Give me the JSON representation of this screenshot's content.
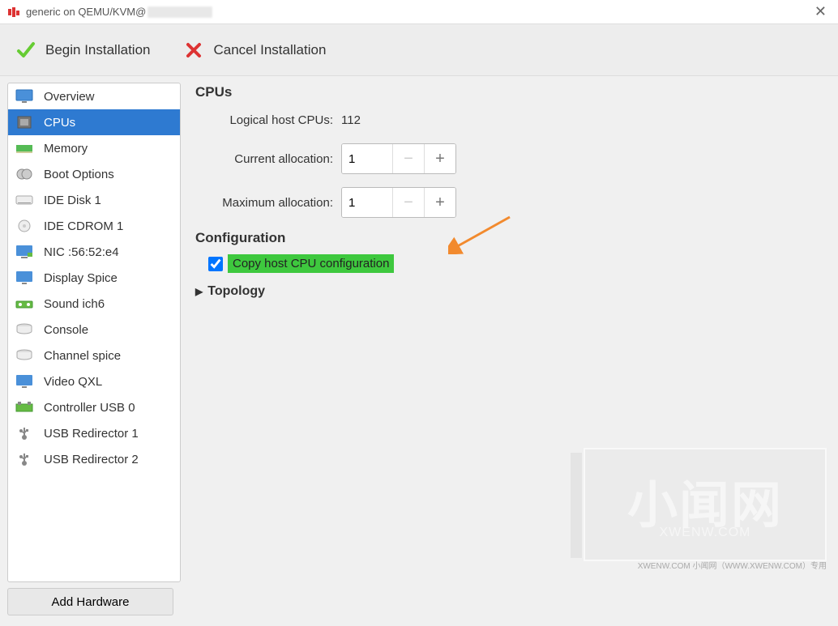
{
  "titlebar": {
    "icon": "virt-manager-icon",
    "title_prefix": "generic on QEMU/KVM@"
  },
  "toolbar": {
    "begin_label": "Begin Installation",
    "cancel_label": "Cancel Installation"
  },
  "sidebar": {
    "items": [
      {
        "icon": "monitor-icon",
        "label": "Overview"
      },
      {
        "icon": "cpu-icon",
        "label": "CPUs",
        "selected": true
      },
      {
        "icon": "memory-icon",
        "label": "Memory"
      },
      {
        "icon": "boot-icon",
        "label": "Boot Options"
      },
      {
        "icon": "disk-icon",
        "label": "IDE Disk 1"
      },
      {
        "icon": "cdrom-icon",
        "label": "IDE CDROM 1"
      },
      {
        "icon": "nic-icon",
        "label": "NIC :56:52:e4"
      },
      {
        "icon": "display-icon",
        "label": "Display Spice"
      },
      {
        "icon": "sound-icon",
        "label": "Sound ich6"
      },
      {
        "icon": "console-icon",
        "label": "Console"
      },
      {
        "icon": "channel-icon",
        "label": "Channel spice"
      },
      {
        "icon": "video-icon",
        "label": "Video QXL"
      },
      {
        "icon": "controller-icon",
        "label": "Controller USB 0"
      },
      {
        "icon": "usb-icon",
        "label": "USB Redirector 1"
      },
      {
        "icon": "usb-icon",
        "label": "USB Redirector 2"
      }
    ],
    "add_hardware_label": "Add Hardware"
  },
  "content": {
    "cpus_title": "CPUs",
    "logical_label": "Logical host CPUs:",
    "logical_value": "112",
    "current_label": "Current allocation:",
    "current_value": "1",
    "max_label": "Maximum allocation:",
    "max_value": "1",
    "config_title": "Configuration",
    "copy_host_label": "Copy host CPU configuration",
    "copy_host_checked": true,
    "topology_label": "Topology"
  },
  "watermark": {
    "text": "小闻网",
    "sub": "XWENW.COM",
    "footer": "XWENW.COM   小闻网（WWW.XWENW.COM）专用"
  },
  "annotation": {
    "arrow_color": "#f28a2e"
  }
}
